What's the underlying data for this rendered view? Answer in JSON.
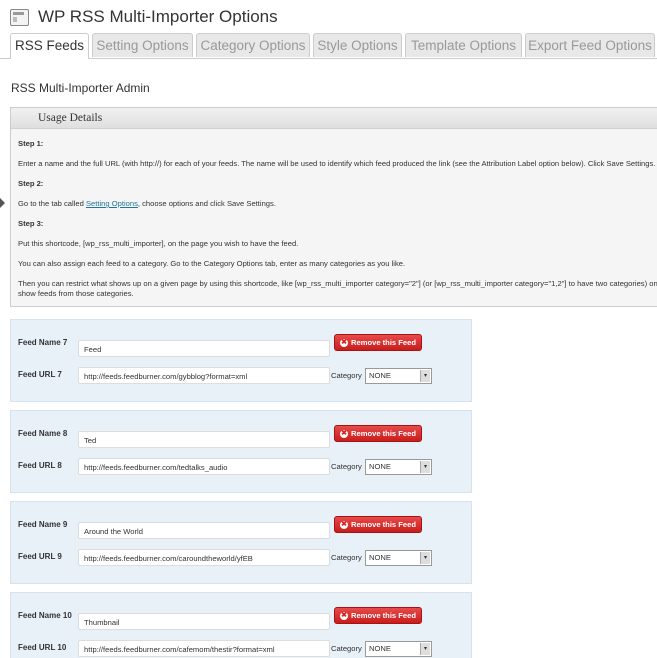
{
  "header": {
    "title": "WP RSS Multi-Importer Options",
    "icon": "settings-page-icon"
  },
  "tabs": [
    {
      "label": "RSS Feeds",
      "active": true
    },
    {
      "label": "Setting Options",
      "active": false
    },
    {
      "label": "Category Options",
      "active": false
    },
    {
      "label": "Style Options",
      "active": false
    },
    {
      "label": "Template Options",
      "active": false
    },
    {
      "label": "Export Feed Options",
      "active": false
    }
  ],
  "admin_title": "RSS Multi-Importer Admin",
  "usage": {
    "heading": "Usage Details",
    "step1_title": "Step 1:",
    "step1_text": "Enter a name and the full URL (with http://) for each of your feeds. The name will be used to identify which feed produced the link (see the Attribution Label option below). Click Save Settings.",
    "step2_title": "Step 2:",
    "step2_prefix": "Go to the tab called ",
    "step2_link": "Setting Options",
    "step2_suffix": ", choose options and click Save Settings.",
    "step3_title": "Step 3:",
    "step3_text": "Put this shortcode, [wp_rss_multi_importer], on the page you wish to have the feed.",
    "step3_text2": "You can also assign each feed to a category. Go to the Category Options tab, enter as many categories as you like.",
    "step3_text3": "Then you can restrict what shows up on a given page by using this shortcode, like [wp_rss_multi_importer category=\"2\"] (or [wp_rss_multi_importer category=\"1,2\"] to have two categories) on",
    "step3_text4": "show feeds from those categories."
  },
  "feeds": [
    {
      "name_label": "Feed Name 7",
      "name": "Feed",
      "url_label": "Feed URL 7",
      "url": "http://feeds.feedburner.com/gybblog?format=xml",
      "remove_label": "Remove this Feed",
      "category_label": "Category",
      "category": "NONE"
    },
    {
      "name_label": "Feed Name 8",
      "name": "Ted",
      "url_label": "Feed URL 8",
      "url": "http://feeds.feedburner.com/tedtalks_audio",
      "remove_label": "Remove this Feed",
      "category_label": "Category",
      "category": "NONE"
    },
    {
      "name_label": "Feed Name 9",
      "name": "Around the World",
      "url_label": "Feed URL 9",
      "url": "http://feeds.feedburner.com/caroundtheworld/yfEB",
      "remove_label": "Remove this Feed",
      "category_label": "Category",
      "category": "NONE"
    },
    {
      "name_label": "Feed Name 10",
      "name": "Thumbnail",
      "url_label": "Feed URL 10",
      "url": "http://feeds.feedburner.com/cafemom/thestir?format=xml",
      "remove_label": "Remove this Feed",
      "category_label": "Category",
      "category": "NONE"
    }
  ],
  "colors": {
    "remove_button": "#d62a2a",
    "feed_box_bg": "#e8f0f8",
    "link": "#21759b"
  }
}
